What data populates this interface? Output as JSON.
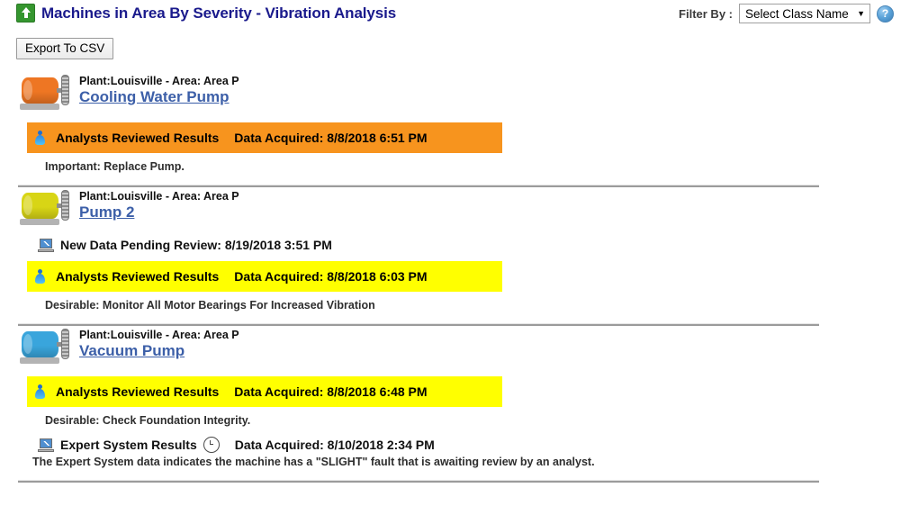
{
  "header": {
    "title": "Machines in Area By Severity - Vibration Analysis",
    "title_icon": "arrow-up-green-icon",
    "filter_label": "Filter By :",
    "filter_value": "Select Class Name",
    "filter_caret": "▼",
    "help_icon_label": "?"
  },
  "toolbar": {
    "export_label": "Export To CSV"
  },
  "colors": {
    "severe_orange": "#F7941E",
    "caution_yellow": "#FFFF00",
    "title_blue": "#1A1A8C",
    "link_blue": "#3C5FA8",
    "divider_gray": "#9B9B9B"
  },
  "machines": [
    {
      "location": "Plant:Louisville - Area: Area P",
      "name": "Cooling Water Pump",
      "icon": "motor-icon",
      "icon_color": "#EE7623",
      "pending": null,
      "status": {
        "icon": "analyst-person-icon",
        "label": "Analysts Reviewed Results",
        "date": "Data Acquired: 8/8/2018 6:51 PM",
        "severity": "severe",
        "bg": "#F7941E"
      },
      "recommendation": "Important: Replace Pump.",
      "expert": null
    },
    {
      "location": "Plant:Louisville - Area: Area P",
      "name": "Pump 2",
      "icon": "motor-icon",
      "icon_color": "#D8D515",
      "pending": {
        "icon": "laptop-icon",
        "text": "New Data Pending Review: 8/19/2018 3:51 PM"
      },
      "status": {
        "icon": "analyst-person-icon",
        "label": "Analysts Reviewed Results",
        "date": "Data Acquired: 8/8/2018 6:03 PM",
        "severity": "caution",
        "bg": "#FFFF00"
      },
      "recommendation": "Desirable: Monitor All Motor Bearings For Increased Vibration",
      "expert": null
    },
    {
      "location": "Plant:Louisville - Area: Area P",
      "name": "Vacuum Pump",
      "icon": "motor-icon",
      "icon_color": "#39A5DC",
      "pending": null,
      "status": {
        "icon": "analyst-person-icon",
        "label": "Analysts Reviewed Results",
        "date": "Data Acquired: 8/8/2018 6:48 PM",
        "severity": "caution",
        "bg": "#FFFF00"
      },
      "recommendation": "Desirable: Check Foundation Integrity.",
      "expert": {
        "icon": "laptop-icon",
        "label": "Expert System Results",
        "clock_icon": "clock-icon",
        "date": "Data Acquired: 8/10/2018 2:34 PM",
        "description": "The Expert System data indicates the machine has a \"SLIGHT\" fault that is awaiting review by an analyst."
      }
    }
  ]
}
